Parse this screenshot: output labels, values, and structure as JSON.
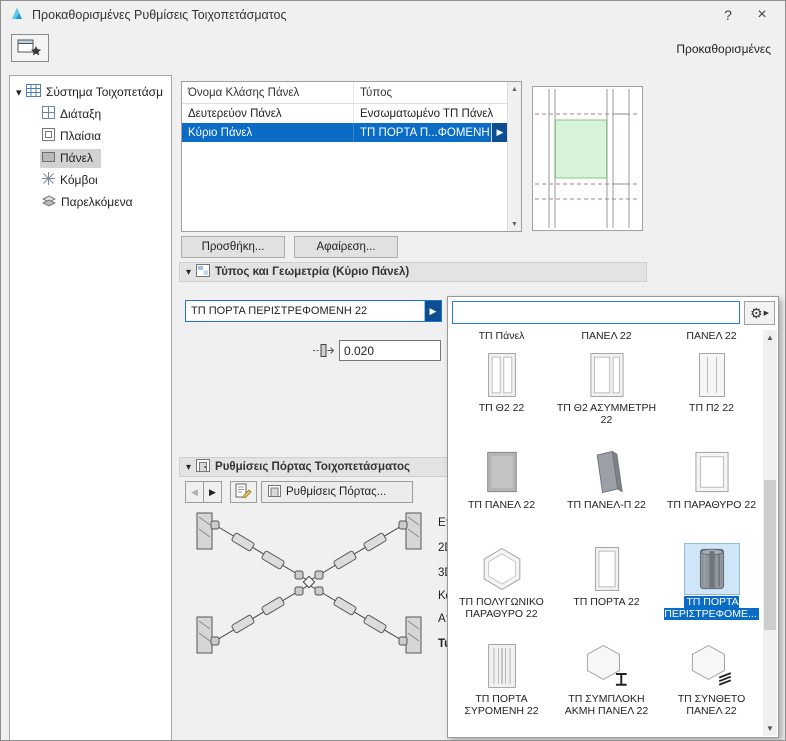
{
  "window": {
    "title": "Προκαθορισμένες Ρυθμίσεις Τοιχοπετάσματος"
  },
  "icons": {
    "help": "?",
    "close": "×",
    "caret": "▾",
    "back": "◀",
    "forward": "▶",
    "up": "▲",
    "down": "▼",
    "gear": "⚙",
    "flyout": "▶"
  },
  "toolbar": {
    "presets_label": "Προκαθορισμένες"
  },
  "tree": {
    "root_label": "Σύστημα Τοιχοπετάσμ",
    "items": [
      {
        "label": "Διάταξη"
      },
      {
        "label": "Πλαίσια"
      },
      {
        "label": "Πάνελ",
        "selected": true
      },
      {
        "label": "Κόμβοι"
      },
      {
        "label": "Παρελκόμενα"
      }
    ]
  },
  "class_table": {
    "columns": [
      "Όνομα Κλάσης Πάνελ",
      "Τύπος"
    ],
    "rows": [
      {
        "name": "Δευτερεύον Πάνελ",
        "type": "Ενσωματωμένο ΤΠ Πάνελ"
      },
      {
        "name": "Κύριο Πάνελ",
        "type": "ΤΠ ΠΟΡΤΑ Π...ΦΟΜΕΝΗ 22",
        "selected": true
      }
    ],
    "add_button": "Προσθήκη...",
    "remove_button": "Αφαίρεση..."
  },
  "sections": {
    "geometry": "Τύπος και Γεωμετρία (Κύριο Πάνελ)",
    "door": "Ρυθμίσεις Πόρτας Τοιχοπετάσματος"
  },
  "geometry": {
    "selected_type": "ΤΠ ΠΟΡΤΑ ΠΕΡΙΣΤΡΕΦΟΜΕΝΗ 22",
    "thickness_value": "0.020"
  },
  "door_settings": {
    "tab_label": "Ρυθμίσεις Πόρτας...",
    "partial_labels": [
      "Επ",
      "2D",
      "3D",
      "Κατ",
      "Απ",
      "Τύπ"
    ]
  },
  "popup": {
    "search_value": "",
    "scrolled_row_labels": [
      "ΤΠ Πάνελ",
      "ΠΑΝΕΛ 22",
      "ΠΑΝΕΛ 22"
    ],
    "items": [
      {
        "label": "ΤΠ Θ2 22",
        "icon": "panel-theta2"
      },
      {
        "label": "ΤΠ Θ2 ΑΣΥΜΜΕΤΡΗ 22",
        "icon": "panel-theta2-asym"
      },
      {
        "label": "ΤΠ Π2 22",
        "icon": "panel-p2"
      },
      {
        "label": "ΤΠ ΠΑΝΕΛ 22",
        "icon": "panel-solid"
      },
      {
        "label": "ΤΠ ΠΑΝΕΛ-Π 22",
        "icon": "panel-3d"
      },
      {
        "label": "ΤΠ ΠΑΡΑΘΥΡΟ 22",
        "icon": "window"
      },
      {
        "label": "ΤΠ ΠΟΛΥΓΩΝΙΚΟ ΠΑΡΑΘΥΡΟ 22",
        "icon": "polygonal-window"
      },
      {
        "label": "ΤΠ ΠΟΡΤΑ 22",
        "icon": "door"
      },
      {
        "label": "ΤΠ ΠΟΡΤΑ ΠΕΡΙΣΤΡΕΦΟΜΕ...",
        "icon": "revolving-door",
        "selected": true
      },
      {
        "label": "ΤΠ ΠΟΡΤΑ ΣΥΡΟΜΕΝΗ 22",
        "icon": "sliding-door"
      },
      {
        "label": "ΤΠ ΣΥΜΠΛΟΚΗ ΑΚΜΗ ΠΑΝΕΛ 22",
        "icon": "complex-edge-panel"
      },
      {
        "label": "ΤΠ ΣΥΝΘΕΤΟ ΠΑΝΕΛ 22",
        "icon": "composite-panel"
      }
    ]
  },
  "colors": {
    "selection": "#0a6cc4",
    "accent_border": "#2a7fd4",
    "selected_tile_bg": "#cfe6f8"
  }
}
